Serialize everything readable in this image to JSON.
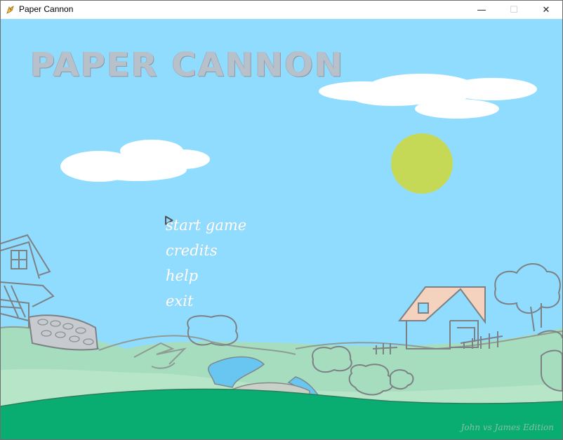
{
  "window": {
    "title": "Paper Cannon",
    "minimize_glyph": "—",
    "maximize_glyph": "☐",
    "close_glyph": "✕"
  },
  "game": {
    "logo_text": "PAPER CANNON",
    "menu": [
      {
        "label": "start game",
        "selected": true
      },
      {
        "label": "credits",
        "selected": false
      },
      {
        "label": "help",
        "selected": false
      },
      {
        "label": "exit",
        "selected": false
      }
    ],
    "edition_text": "John vs James Edition"
  },
  "colors": {
    "sky": "#8fdcff",
    "sun": "#c6d957",
    "grass_dark": "#09ad72",
    "grass_light": "#a6ddbf",
    "river": "#69c6f0",
    "house_roof": "#f4d2bd"
  }
}
